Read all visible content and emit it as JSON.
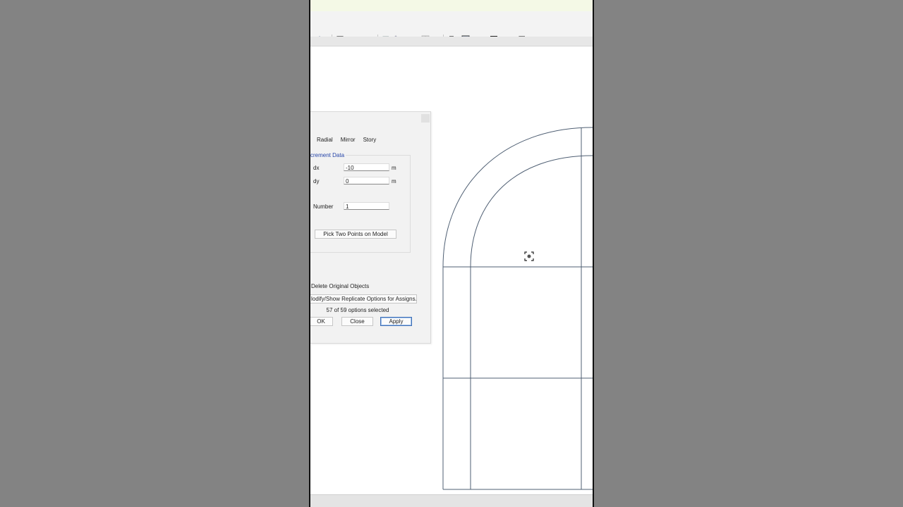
{
  "toolbar": {
    "icons": [
      "select-icon",
      "view-3d-icon",
      "draw-frame-icon",
      "draw-brace-icon",
      "draw-wall-icon",
      "draw-deck-icon",
      "draw-column-icon",
      "draw-link-icon",
      "draw-beam-icon",
      "draw-rebar-icon",
      "draw-grid-icon",
      "draw-slab-icon",
      "draw-section-icon",
      "draw-ibeam-icon",
      "draw-wall-stack-icon",
      "draw-dimension-icon",
      "draw-line-icon"
    ]
  },
  "dialog": {
    "tabs": [
      "Radial",
      "Mirror",
      "Story"
    ],
    "group_title": "crement Data",
    "fields": {
      "dx": {
        "label": "dx",
        "value": "-10",
        "unit": "m"
      },
      "dy": {
        "label": "dy",
        "value": "0",
        "unit": "m"
      },
      "number": {
        "label": "Number",
        "value": "1"
      }
    },
    "pick_button": "Pick Two Points on Model",
    "delete_original": "Delete Original Objects",
    "modify_button": "lodify/Show Replicate Options for Assigns...",
    "options_selected": "57 of 59 options selected",
    "ok": "OK",
    "close": "Close",
    "apply": "Apply"
  },
  "colors": {
    "model_lines": "#4f5f73",
    "accent": "#3f6fb6",
    "group_title": "#2444a8"
  }
}
